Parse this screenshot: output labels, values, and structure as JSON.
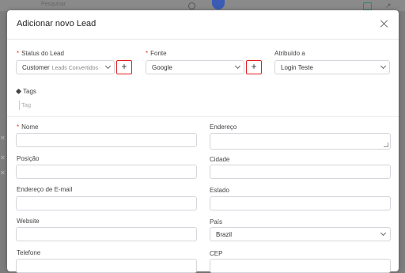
{
  "background": {
    "search_placeholder": "Pesquisar",
    "avatar_color": "#3b5bb5"
  },
  "modal": {
    "title": "Adicionar novo Lead",
    "status": {
      "label": "Status do Lead",
      "value": "Customer",
      "value_sub": "Leads Convertidos",
      "add_label": "+"
    },
    "fonte": {
      "label": "Fonte",
      "value": "Google",
      "add_label": "+"
    },
    "atribuido": {
      "label": "Atribuído a",
      "value": "Login Teste"
    },
    "tags": {
      "label": "Tags",
      "placeholder": "Tag"
    },
    "left_fields": [
      {
        "label": "Nome",
        "required": true
      },
      {
        "label": "Posição"
      },
      {
        "label": "Endereço de E-mail"
      },
      {
        "label": "Website"
      },
      {
        "label": "Telefone"
      }
    ],
    "right_fields": [
      {
        "label": "Endereço"
      },
      {
        "label": "Cidade"
      },
      {
        "label": "Estado"
      },
      {
        "label": "País",
        "value": "Brazil"
      },
      {
        "label": "CEP"
      }
    ],
    "required_marker": "*",
    "highlight_color": "#e02020"
  }
}
